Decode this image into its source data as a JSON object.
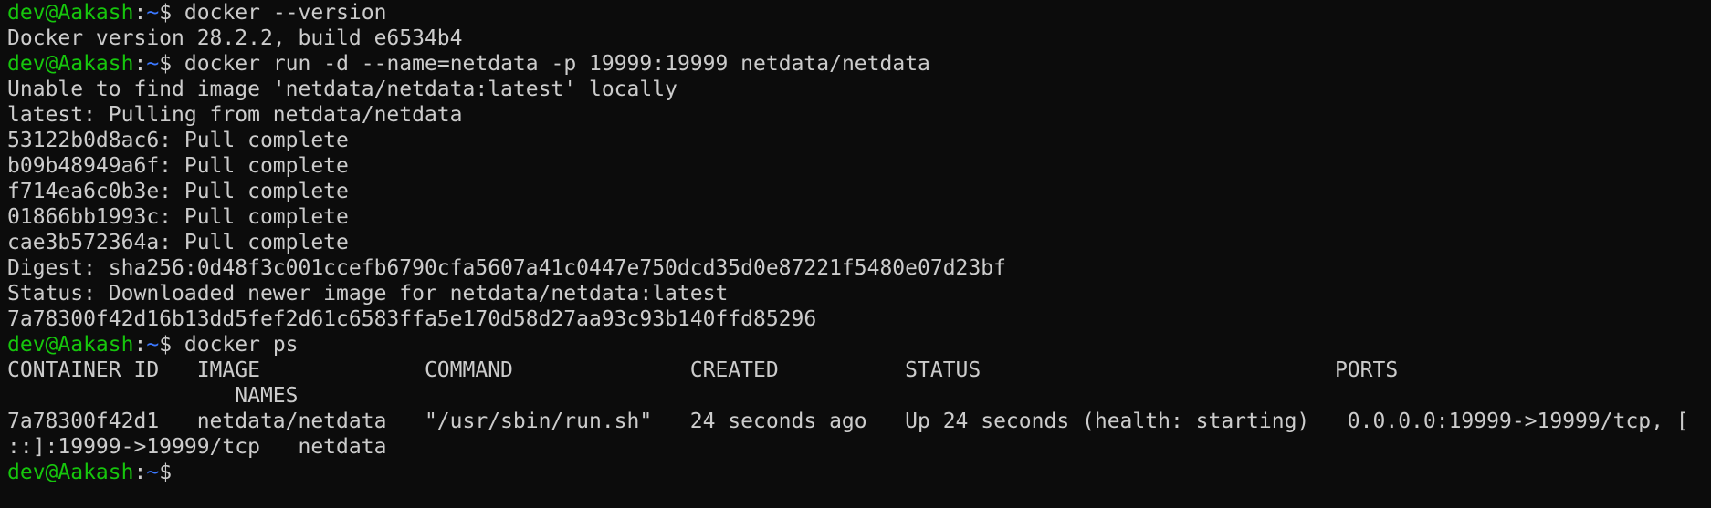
{
  "prompt": {
    "user": "dev@Aakash",
    "sep": ":",
    "path": "~",
    "symbol": "$ "
  },
  "colors": {
    "background": "#0c0c0c",
    "text": "#cccccc",
    "user": "#16c60c",
    "path": "#3b78ff"
  },
  "commands": [
    "docker --version",
    "docker run -d --name=netdata -p 19999:19999 netdata/netdata",
    "docker ps",
    ""
  ],
  "outputs": {
    "version": [
      "Docker version 28.2.2, build e6534b4"
    ],
    "run": [
      "Unable to find image 'netdata/netdata:latest' locally",
      "latest: Pulling from netdata/netdata",
      "53122b0d8ac6: Pull complete",
      "b09b48949a6f: Pull complete",
      "f714ea6c0b3e: Pull complete",
      "01866bb1993c: Pull complete",
      "cae3b572364a: Pull complete",
      "Digest: sha256:0d48f3c001ccefb6790cfa5607a41c0447e750dcd35d0e87221f5480e07d23bf",
      "Status: Downloaded newer image for netdata/netdata:latest",
      "7a78300f42d16b13dd5fef2d61c6583ffa5e170d58d27aa93c93b140ffd85296"
    ],
    "ps": [
      "CONTAINER ID   IMAGE             COMMAND              CREATED          STATUS                            PORTS",
      "                  NAMES",
      "7a78300f42d1   netdata/netdata   \"/usr/sbin/run.sh\"   24 seconds ago   Up 24 seconds (health: starting)   0.0.0.0:19999->19999/tcp, [",
      "::]:19999->19999/tcp   netdata"
    ]
  }
}
